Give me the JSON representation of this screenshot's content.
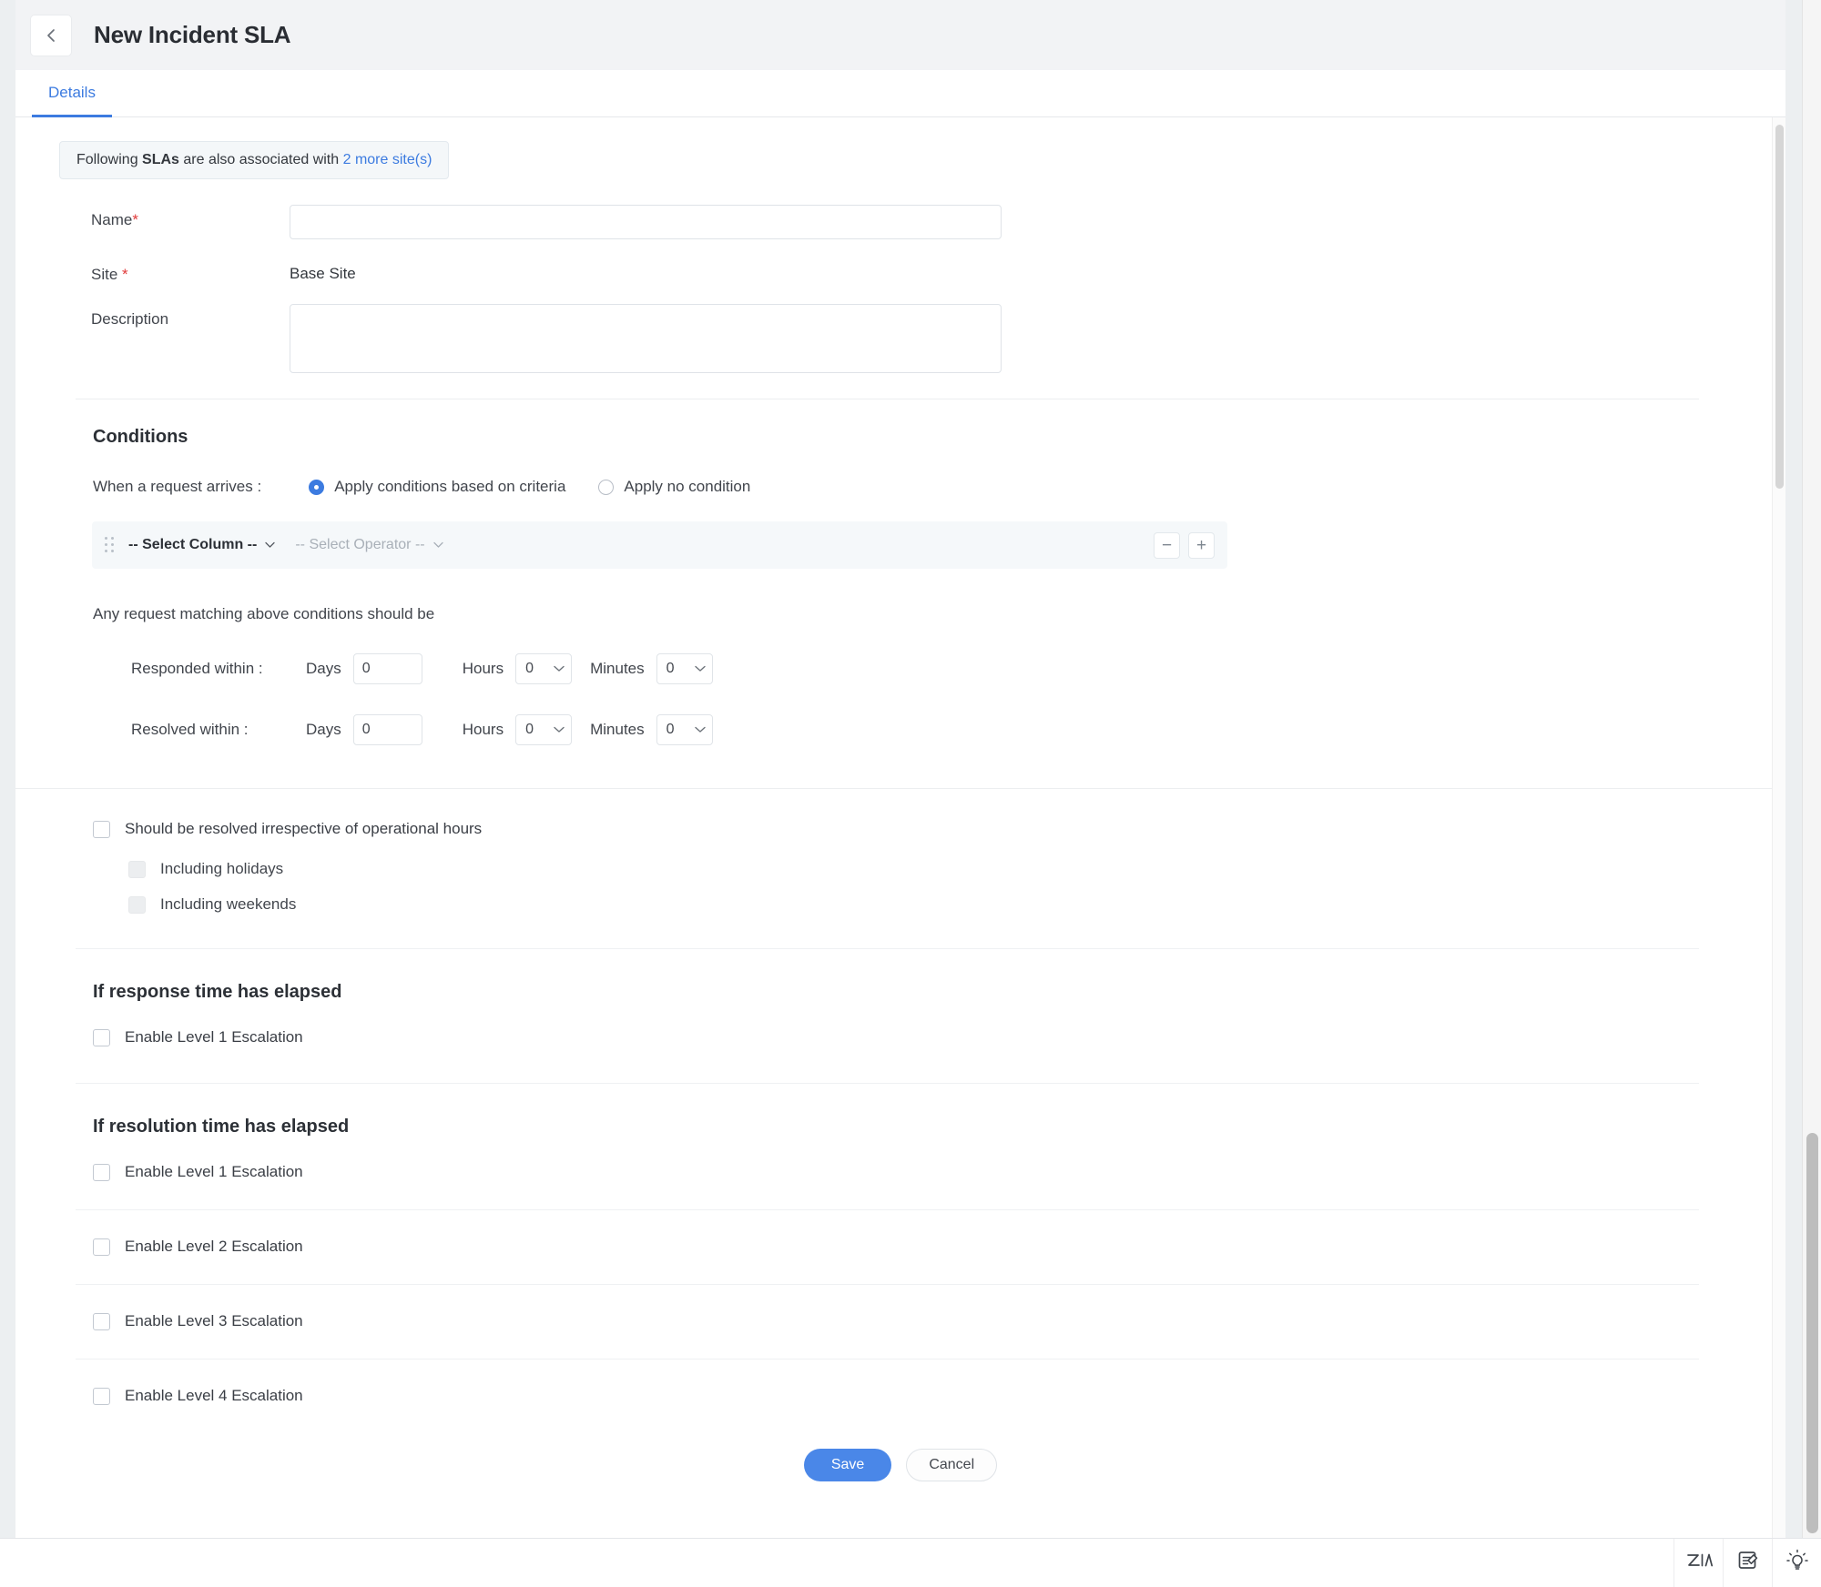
{
  "header": {
    "back_icon": "arrow-left-icon",
    "title": "New Incident SLA"
  },
  "tabs": [
    {
      "label": "Details",
      "active": true
    }
  ],
  "banner": {
    "prefix": "Following ",
    "bold": "SLAs",
    "middle": " are also associated with ",
    "link": "2 more site(s)"
  },
  "form": {
    "name": {
      "label": "Name",
      "required": "*",
      "value": "",
      "placeholder": ""
    },
    "site": {
      "label": "Site",
      "required": "*",
      "value": "Base Site"
    },
    "description": {
      "label": "Description",
      "value": "",
      "placeholder": ""
    }
  },
  "conditions": {
    "title": "Conditions",
    "when_label": "When a request arrives :",
    "options": [
      {
        "label": "Apply conditions based on criteria",
        "selected": true
      },
      {
        "label": "Apply no condition",
        "selected": false
      }
    ],
    "criteria_row": {
      "drag_icon": "drag-handle-icon",
      "column_select": "-- Select Column --",
      "operator_select": "-- Select Operator --",
      "remove_label": "−",
      "add_label": "+"
    },
    "match_text": "Any request matching above conditions should be",
    "time_rows": [
      {
        "label": "Responded within :",
        "days_label": "Days",
        "days_value": "0",
        "hours_label": "Hours",
        "hours_value": "0",
        "minutes_label": "Minutes",
        "minutes_value": "0"
      },
      {
        "label": "Resolved within :",
        "days_label": "Days",
        "days_value": "0",
        "hours_label": "Hours",
        "hours_value": "0",
        "minutes_label": "Minutes",
        "minutes_value": "0"
      }
    ]
  },
  "operational": {
    "main": {
      "label": "Should be resolved irrespective of operational hours",
      "checked": false
    },
    "sub": [
      {
        "label": "Including holidays",
        "checked": false,
        "disabled": true
      },
      {
        "label": "Including weekends",
        "checked": false,
        "disabled": true
      }
    ]
  },
  "response_escalation": {
    "title": "If response time has elapsed",
    "items": [
      {
        "label": "Enable Level 1 Escalation",
        "checked": false
      }
    ]
  },
  "resolution_escalation": {
    "title": "If resolution time has elapsed",
    "items": [
      {
        "label": "Enable Level 1 Escalation",
        "checked": false
      },
      {
        "label": "Enable Level 2 Escalation",
        "checked": false
      },
      {
        "label": "Enable Level 3 Escalation",
        "checked": false
      },
      {
        "label": "Enable Level 4 Escalation",
        "checked": false
      }
    ]
  },
  "actions": {
    "save": "Save",
    "cancel": "Cancel"
  },
  "appbar": {
    "items": [
      {
        "icon": "zia-assistant-icon"
      },
      {
        "icon": "notes-edit-icon"
      },
      {
        "icon": "lightbulb-icon"
      }
    ]
  },
  "colors": {
    "accent": "#3c7be0",
    "save_button": "#4a87e8",
    "required_asterisk": "#e03a3a",
    "header_bg": "#f2f3f5",
    "criteria_bg": "#f5f8fa",
    "banner_bg": "#f4f7f9"
  }
}
